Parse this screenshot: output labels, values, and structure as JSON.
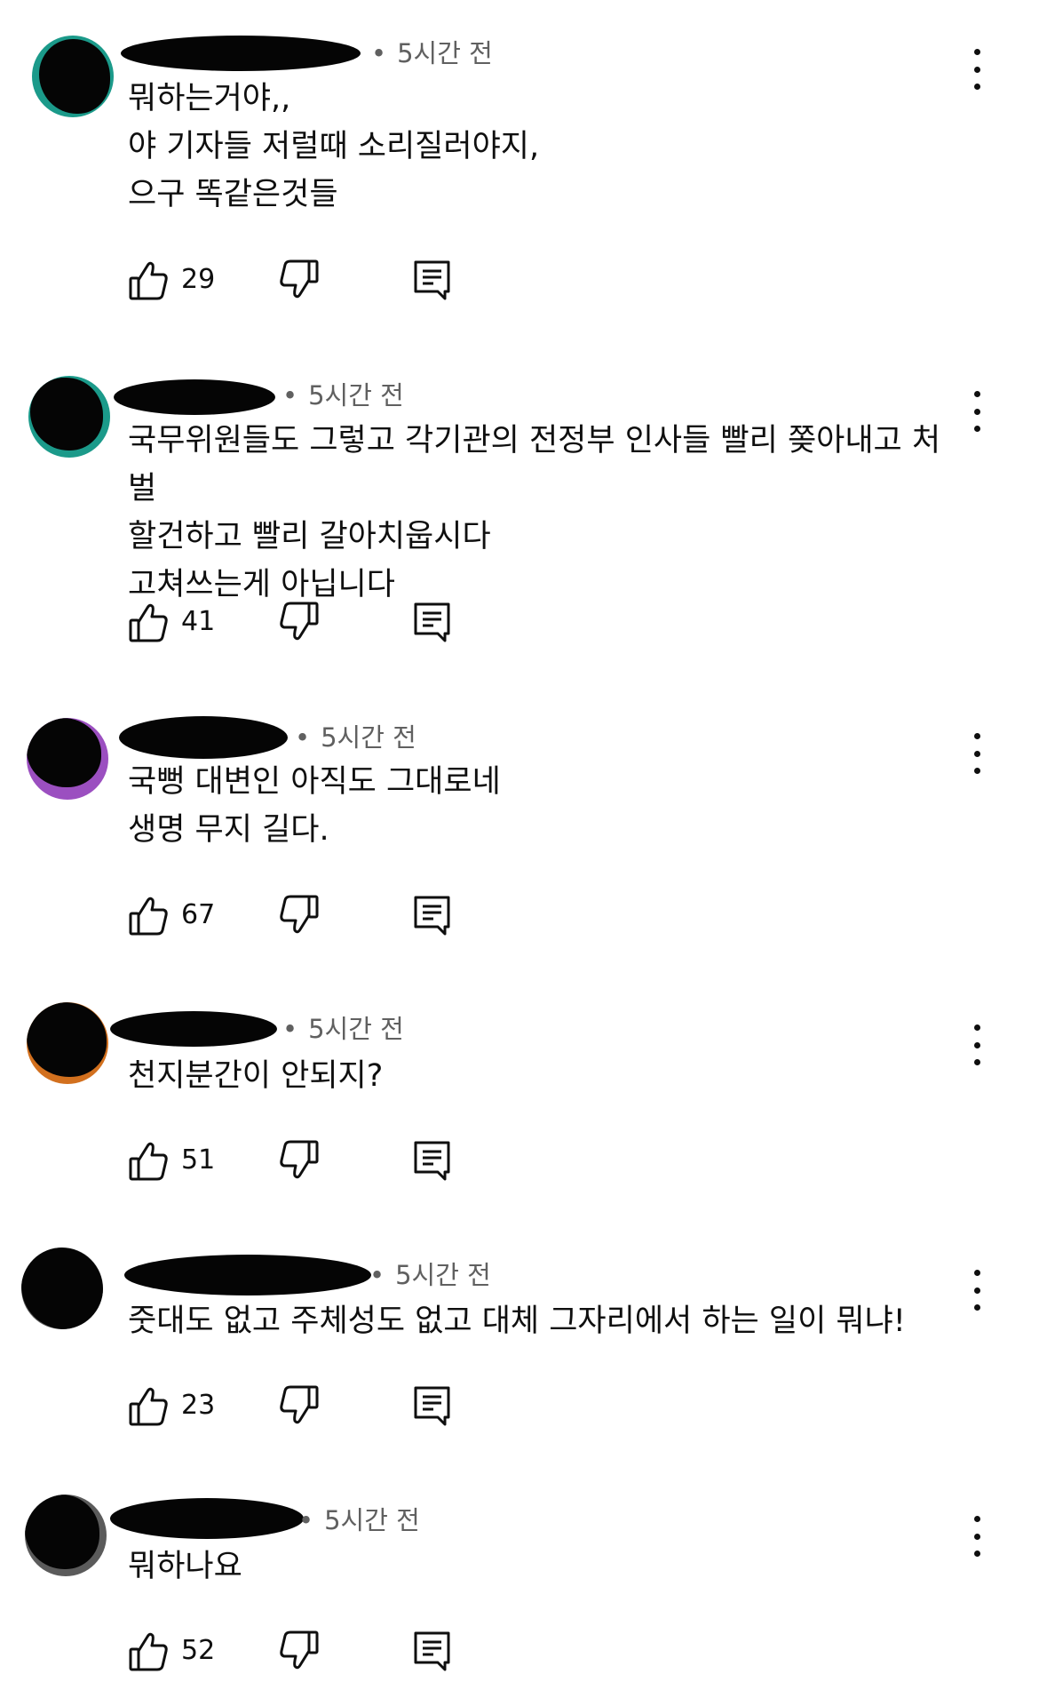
{
  "comments": [
    {
      "time": "5시간 전",
      "text": "뭐하는거야,,\n야  기자들 저럴때  소리질러야지,\n으구  똑같은것들",
      "likes": "29",
      "avatar_color": "#1b9a8a"
    },
    {
      "time": "5시간 전",
      "text": "국무위원들도 그렇고 각기관의 전정부 인사들 빨리 쫒아내고 처벌\n할건하고 빨리 갈아치웁시다\n고쳐쓰는게 아닙니다",
      "likes": "41",
      "avatar_color": "#1b9a8a"
    },
    {
      "time": "5시간 전",
      "text": "국뻥 대변인 아직도 그대로네\n생명 무지 길다.",
      "likes": "67",
      "avatar_color": "#9b4fc0"
    },
    {
      "time": "5시간 전",
      "text": "천지분간이 안되지?",
      "likes": "51",
      "avatar_color": "#d2701e"
    },
    {
      "time": "5시간 전",
      "text": "줏대도 없고 주체성도 없고 대체 그자리에서 하는 일이 뭐냐!",
      "likes": "23",
      "avatar_color": "#5b5b5b"
    },
    {
      "time": "5시간 전",
      "text": "뭐하나요",
      "likes": "52",
      "avatar_color": "#5b5b5b"
    }
  ]
}
